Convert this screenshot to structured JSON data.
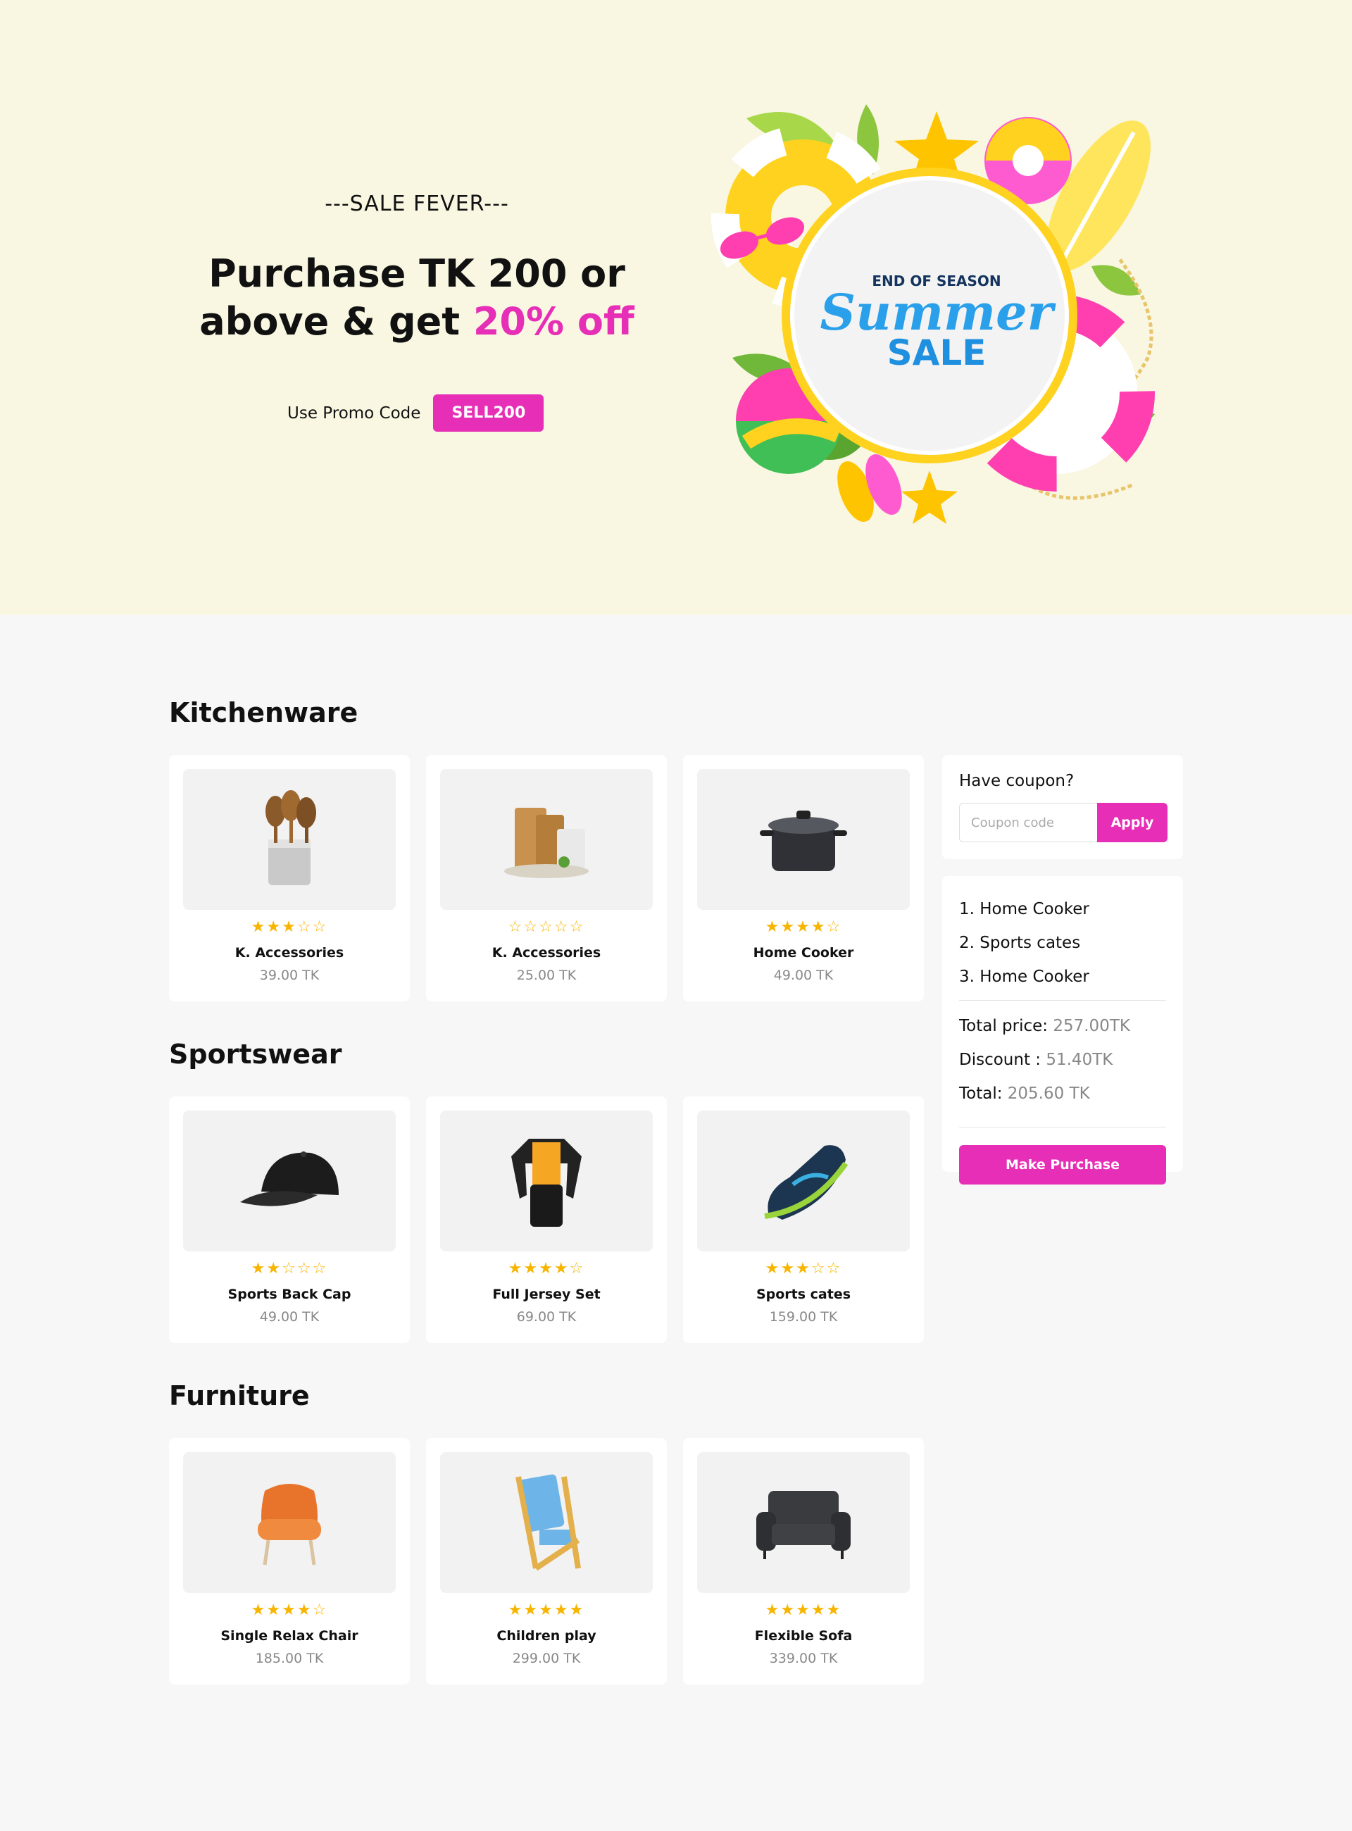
{
  "hero": {
    "kicker": "---SALE FEVER---",
    "headline_line1": "Purchase TK 200 or",
    "headline_line2_prefix": "above & get ",
    "headline_highlight": "20% off",
    "promo_label": "Use Promo Code",
    "promo_code": "SELL200",
    "banner": {
      "top_text": "END OF SEASON",
      "script_text": "Summer",
      "bottom_text": "SALE"
    }
  },
  "colors": {
    "accent": "#e62eb6",
    "hero_bg": "#f9f7e2",
    "page_bg": "#f7f7f7",
    "star": "#f7b500"
  },
  "sections": [
    {
      "title": "Kitchenware",
      "products": [
        {
          "name": "K. Accessories",
          "price": "39.00 TK",
          "rating": 3,
          "icon": "wooden-utensils-icon"
        },
        {
          "name": "K. Accessories",
          "price": "25.00 TK",
          "rating": 0,
          "icon": "cutting-boards-icon"
        },
        {
          "name": "Home Cooker",
          "price": "49.00 TK",
          "rating": 4,
          "icon": "cooking-pot-icon"
        }
      ]
    },
    {
      "title": "Sportswear",
      "products": [
        {
          "name": "Sports Back Cap",
          "price": "49.00 TK",
          "rating": 2,
          "icon": "baseball-cap-icon"
        },
        {
          "name": "Full Jersey Set",
          "price": "69.00 TK",
          "rating": 4,
          "icon": "jersey-suit-icon"
        },
        {
          "name": "Sports cates",
          "price": "159.00 TK",
          "rating": 3,
          "icon": "sneaker-icon"
        }
      ]
    },
    {
      "title": "Furniture",
      "products": [
        {
          "name": "Single Relax Chair",
          "price": "185.00 TK",
          "rating": 4,
          "icon": "armchair-icon"
        },
        {
          "name": "Children play",
          "price": "299.00 TK",
          "rating": 5,
          "icon": "folding-chair-icon"
        },
        {
          "name": "Flexible Sofa",
          "price": "339.00 TK",
          "rating": 5,
          "icon": "sofa-icon"
        }
      ]
    }
  ],
  "coupon": {
    "title": "Have coupon?",
    "placeholder": "Coupon code",
    "apply_label": "Apply"
  },
  "summary": {
    "items": [
      "1. Home Cooker",
      "2. Sports cates",
      "3. Home Cooker"
    ],
    "total_price_label": "Total price:",
    "total_price_value": "257.00TK",
    "discount_label": "Discount :",
    "discount_value": "51.40TK",
    "total_label": "Total:",
    "total_value": "205.60 TK",
    "button_label": "Make Purchase"
  }
}
